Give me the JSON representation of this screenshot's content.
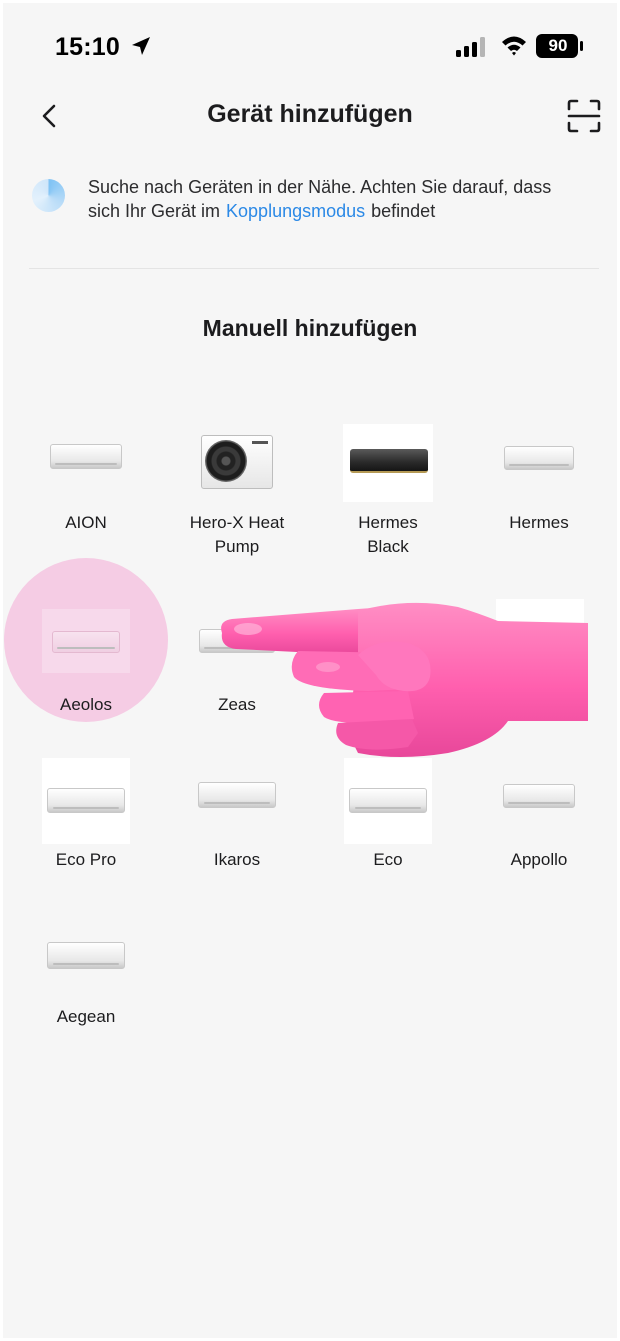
{
  "status_bar": {
    "time": "15:10",
    "battery": "90"
  },
  "header": {
    "title": "Gerät hinzufügen"
  },
  "search": {
    "text_before": "Suche nach Geräten in der Nähe. Achten Sie darauf, dass sich Ihr Gerät im",
    "link": "Kopplungsmodus",
    "text_after": "befindet"
  },
  "manual": {
    "title": "Manuell hinzufügen",
    "devices": [
      {
        "label": "AION"
      },
      {
        "label": "Hero-X Heat Pump"
      },
      {
        "label": "Hermes Black"
      },
      {
        "label": "Hermes"
      },
      {
        "label": "Aeolos"
      },
      {
        "label": "Zeas"
      },
      {
        "label": "Eco Pro"
      },
      {
        "label": "Ikaros"
      },
      {
        "label": "Eco"
      },
      {
        "label": "Appollo"
      },
      {
        "label": "Aegean"
      }
    ]
  },
  "colors": {
    "accent": "#2b89e6",
    "highlight": "#f4aad6",
    "background": "#f6f6f6"
  }
}
